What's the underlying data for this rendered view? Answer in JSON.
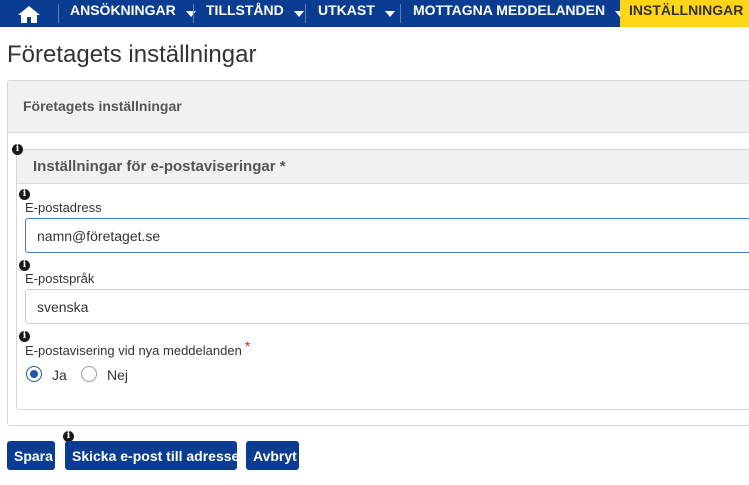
{
  "nav": {
    "home_icon": "home-icon",
    "items": [
      {
        "label": "ANSÖKNINGAR",
        "active": false
      },
      {
        "label": "TILLSTÅND",
        "active": false
      },
      {
        "label": "UTKAST",
        "active": false
      },
      {
        "label": "MOTTAGNA MEDDELANDEN",
        "active": false
      },
      {
        "label": "INSTÄLLNINGAR",
        "active": true
      }
    ],
    "bar_color": "#0a3d91",
    "active_color": "#ffd617"
  },
  "page": {
    "title": "Företagets inställningar"
  },
  "company_panel": {
    "title": "Företagets inställningar"
  },
  "email_panel": {
    "title": "Inställningar för e-postaviseringar *",
    "email": {
      "label": "E-postadress",
      "value": "namn@företaget.se"
    },
    "language": {
      "label": "E-postspråk",
      "value": "svenska"
    },
    "notify": {
      "label": "E-postavisering vid nya meddelanden",
      "required_mark": "*",
      "options": [
        {
          "label": "Ja",
          "checked": true
        },
        {
          "label": "Nej",
          "checked": false
        }
      ]
    }
  },
  "buttons": {
    "save": "Spara",
    "send_email": "Skicka e-post till adressen",
    "cancel": "Avbryt"
  },
  "info_glyph": "i"
}
